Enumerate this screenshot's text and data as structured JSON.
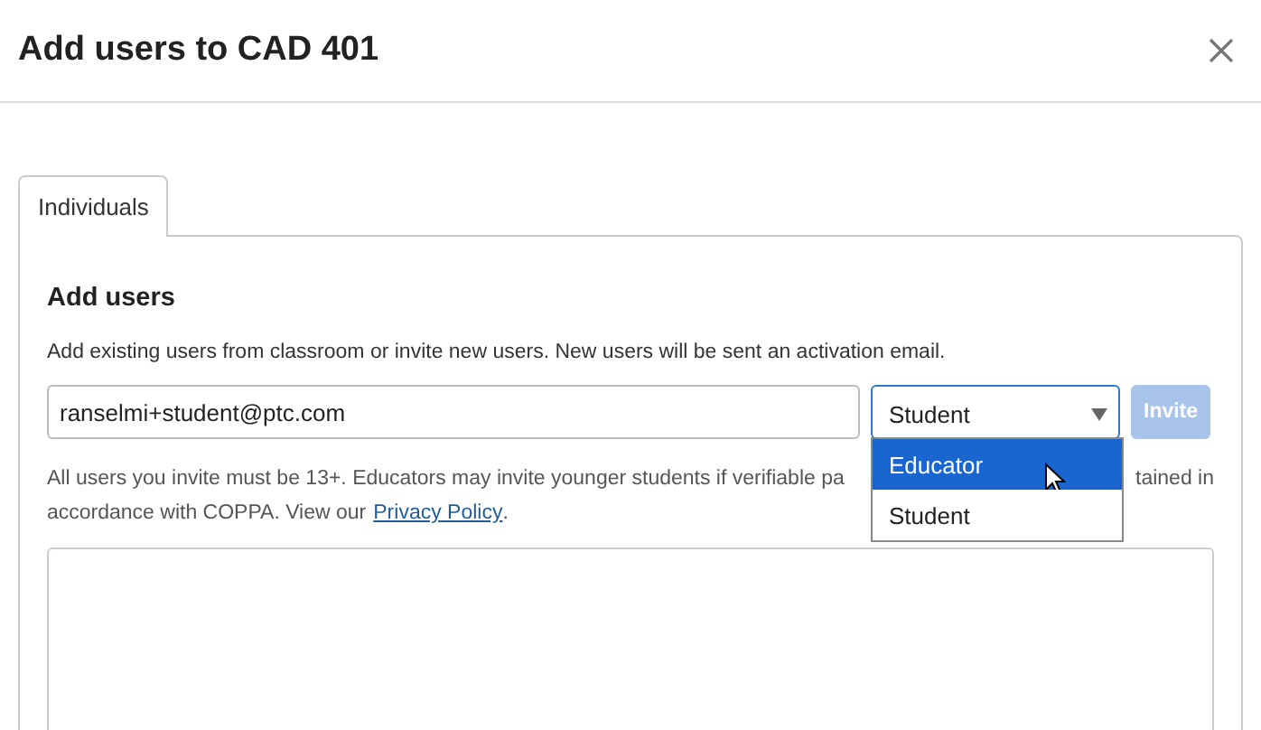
{
  "dialog": {
    "title": "Add users to CAD 401"
  },
  "tabs": [
    {
      "label": "Individuals",
      "selected": true
    }
  ],
  "section": {
    "heading": "Add users",
    "description": "Add existing users from classroom or invite new users. New users will be sent an activation email."
  },
  "email_field": {
    "value": "ranselmi+student@ptc.com"
  },
  "role_select": {
    "value": "Student",
    "expanded": true,
    "options": [
      {
        "label": "Educator",
        "highlighted": true
      },
      {
        "label": "Student",
        "highlighted": false
      }
    ]
  },
  "invite_button": {
    "label": "Invite",
    "disabled": true
  },
  "notice": {
    "line_1_start": "All users you invite must be 13+. Educators may invite younger students if verifiable pa",
    "line_1_end": "tained in",
    "line_2": "accordance with COPPA. View our",
    "link": "Privacy Policy",
    "line_2_end": "."
  }
}
